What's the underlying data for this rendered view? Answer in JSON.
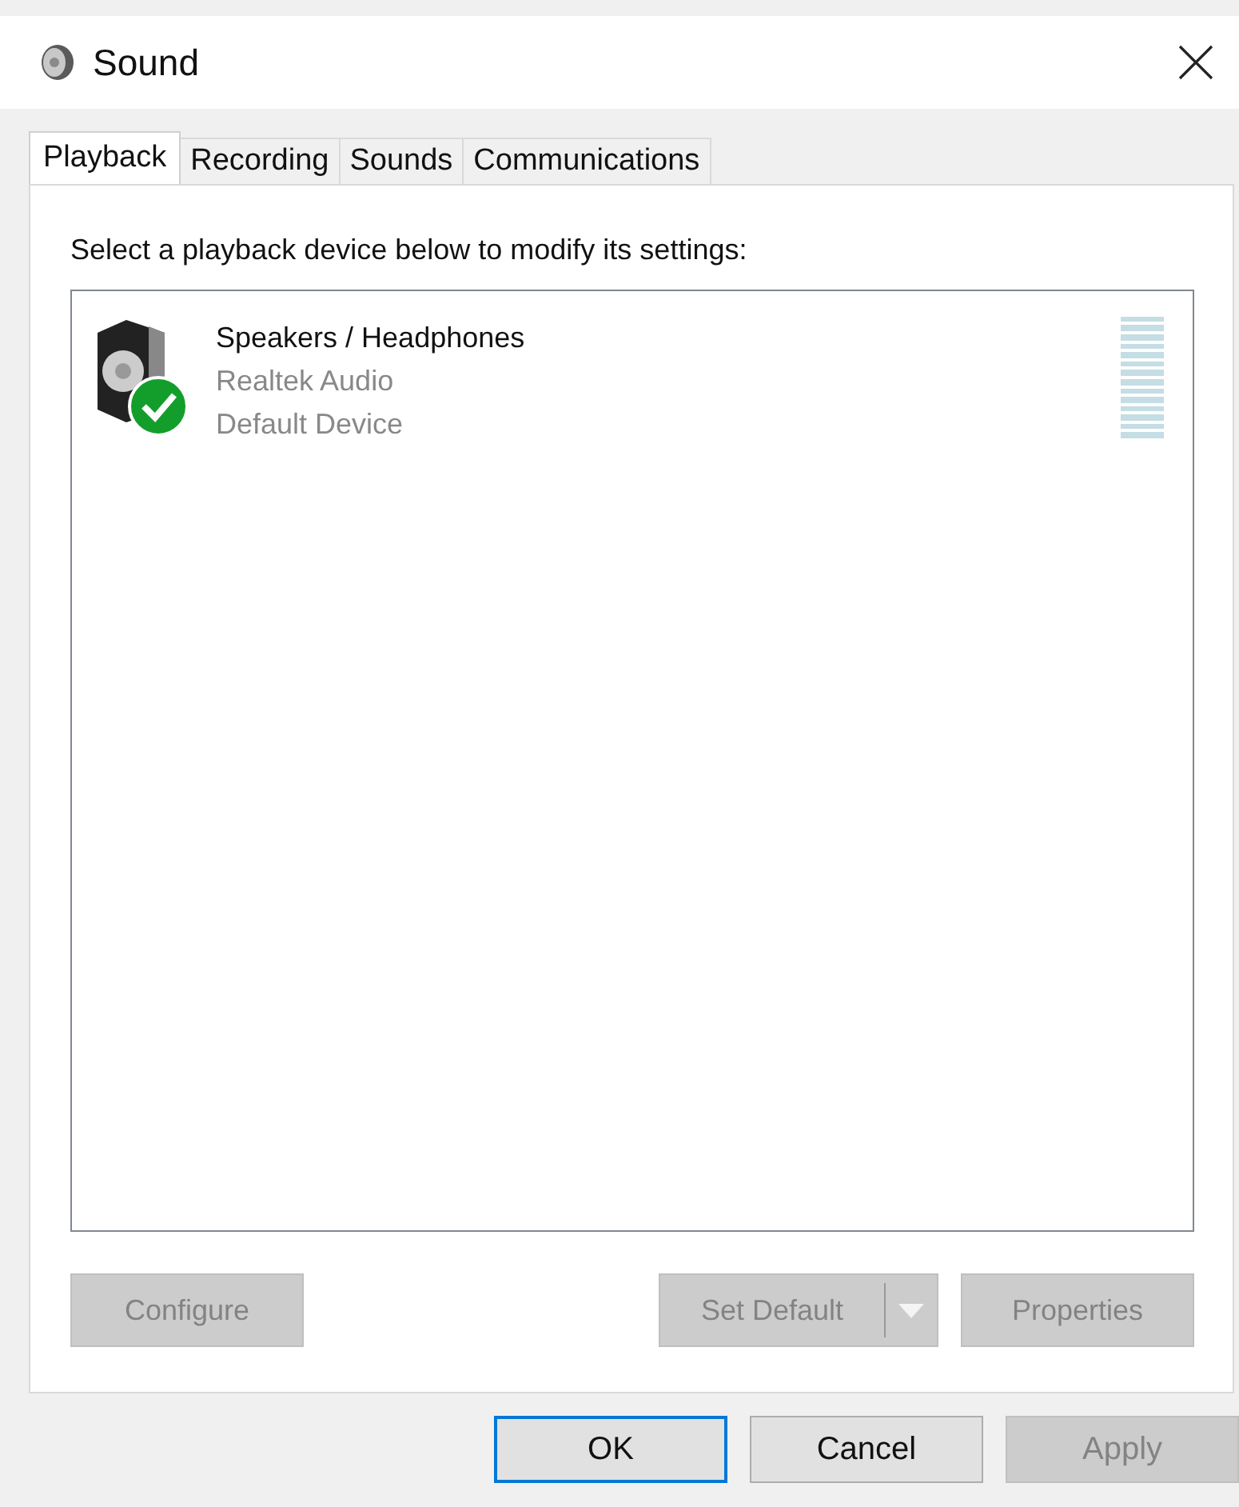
{
  "window": {
    "title": "Sound"
  },
  "tabs": [
    {
      "label": "Playback",
      "selected": true
    },
    {
      "label": "Recording",
      "selected": false
    },
    {
      "label": "Sounds",
      "selected": false
    },
    {
      "label": "Communications",
      "selected": false
    }
  ],
  "instruction": "Select a playback device below to modify its settings:",
  "devices": [
    {
      "name": "Speakers / Headphones",
      "driver": "Realtek Audio",
      "status": "Default Device",
      "default": true,
      "selected": false
    }
  ],
  "device_buttons": [
    {
      "label": "Configure",
      "disabled": true,
      "kind": "plain"
    },
    {
      "label": "Set Default",
      "disabled": true,
      "kind": "split"
    },
    {
      "label": "Properties",
      "disabled": true,
      "kind": "plain"
    }
  ],
  "dialog_buttons": [
    {
      "label": "OK",
      "disabled": false,
      "default": true
    },
    {
      "label": "Cancel",
      "disabled": false,
      "default": false
    },
    {
      "label": "Apply",
      "disabled": true,
      "default": false
    }
  ]
}
